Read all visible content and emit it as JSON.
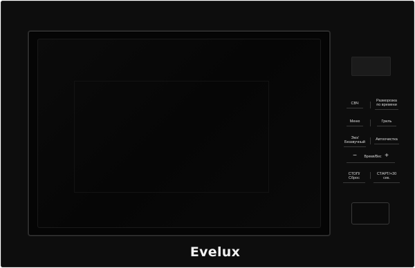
{
  "brand": "Evelux",
  "controls": {
    "microwave": "СВЧ",
    "defrost": "Разморозка по времени",
    "menu": "Меню",
    "grill": "Гриль",
    "eco": "Эко/ Беззвучный",
    "autoclean": "Автоочистка",
    "minus": "−",
    "time_weight": "Время/Вес",
    "plus": "+",
    "stop": "СТОП/Сброс",
    "start": "СТАРТ/+30 сек."
  },
  "colors": {
    "body": "#0d0d0d",
    "label": "#d9d9d9"
  }
}
